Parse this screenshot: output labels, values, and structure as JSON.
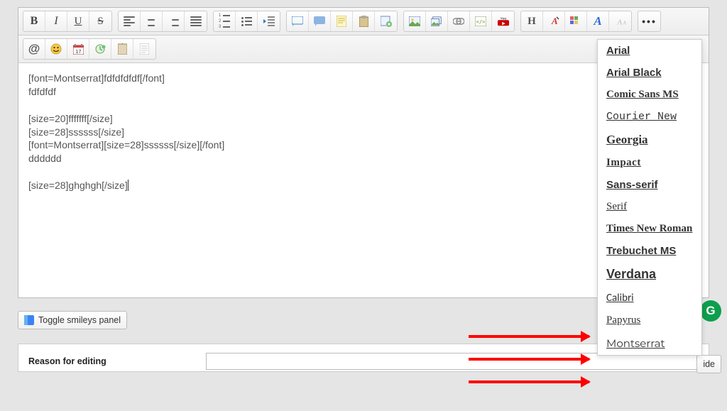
{
  "toolbar": {
    "mention_glyph": "@"
  },
  "editor": {
    "content": "[font=Montserrat]fdfdfdfdf[/font]\nfdfdfdf\n\n[size=20]fffffff[/size]\n[size=28]ssssss[/size]\n[font=Montserrat][size=28]ssssss[/size][/font]\ndddddd\n\n[size=28]ghghgh[/size]"
  },
  "smileys": {
    "toggle_label": "Toggle smileys panel"
  },
  "hide_btn": {
    "label": "ide"
  },
  "reason": {
    "label": "Reason for editing",
    "value": ""
  },
  "fonts": {
    "items": [
      "Arial",
      "Arial Black",
      "Comic Sans MS",
      "Courier New",
      "Georgia",
      "Impact",
      "Sans-serif",
      "Serif",
      "Times New Roman",
      "Trebuchet MS",
      "Verdana",
      "Calibri",
      "Papyrus",
      "Montserrat"
    ]
  },
  "badges": {
    "diamond": "◆",
    "g": "G"
  }
}
